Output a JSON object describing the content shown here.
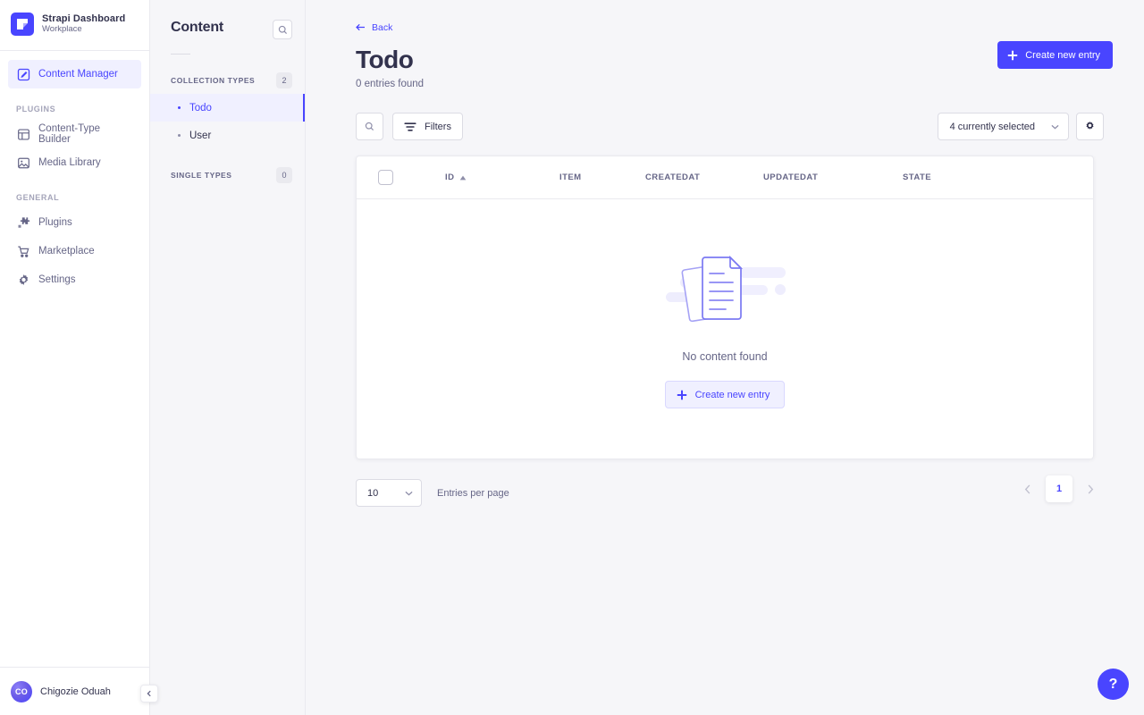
{
  "sidebar": {
    "brand": {
      "title": "Strapi Dashboard",
      "subtitle": "Workplace",
      "logo_icon": "strapi-logo-icon"
    },
    "primary_item": {
      "label": "Content Manager",
      "icon": "pencil-square-icon"
    },
    "sections": [
      {
        "label": "PLUGINS",
        "items": [
          {
            "label": "Content-Type Builder",
            "icon": "layout-icon"
          },
          {
            "label": "Media Library",
            "icon": "image-icon"
          }
        ]
      },
      {
        "label": "GENERAL",
        "items": [
          {
            "label": "Plugins",
            "icon": "puzzle-icon"
          },
          {
            "label": "Marketplace",
            "icon": "shopping-cart-icon"
          },
          {
            "label": "Settings",
            "icon": "gear-icon"
          }
        ]
      }
    ],
    "user": {
      "name": "Chigozie Oduah",
      "initials": "CO",
      "collapse_icon": "chevron-left-icon"
    }
  },
  "content_panel": {
    "title": "Content",
    "search_icon": "search-icon",
    "collection_types": {
      "label": "COLLECTION TYPES",
      "count": "2"
    },
    "collection_items": [
      {
        "label": "Todo",
        "active": true
      },
      {
        "label": "User",
        "active": false
      }
    ],
    "single_types": {
      "label": "SINGLE TYPES",
      "count": "0"
    }
  },
  "main": {
    "back_label": "Back",
    "back_icon": "arrow-left-icon",
    "title": "Todo",
    "subtitle": "0 entries found",
    "create_button": {
      "label": "Create new entry",
      "icon": "plus-icon"
    },
    "highlight_color": "#f20d0d",
    "accent_color": "#4945ff"
  },
  "toolbar": {
    "search_icon": "search-icon",
    "filters_label": "Filters",
    "filters_icon": "filter-icon",
    "field_select_value": "4 currently selected",
    "field_select_icon": "chevron-down-icon",
    "settings_icon": "cog-icon"
  },
  "table": {
    "select_all_checkbox": "select-all",
    "columns": [
      {
        "key": "id",
        "label": "ID",
        "sorted": true,
        "sort_icon": "caret-up-icon"
      },
      {
        "key": "item",
        "label": "ITEM",
        "sorted": false
      },
      {
        "key": "createdat",
        "label": "CREATEDAT",
        "sorted": false
      },
      {
        "key": "updatedat",
        "label": "UPDATEDAT",
        "sorted": false
      },
      {
        "key": "state",
        "label": "STATE",
        "sorted": false
      }
    ],
    "rows": [],
    "empty_state": {
      "illustration": "documents-illustration",
      "text": "No content found",
      "button_label": "Create new entry",
      "button_icon": "plus-icon"
    }
  },
  "pagination": {
    "per_page_value": "10",
    "per_page_label": "Entries per page",
    "per_page_icon": "chevron-down-icon",
    "prev_icon": "chevron-left-icon",
    "next_icon": "chevron-right-icon",
    "current_page": "1"
  },
  "help": {
    "label": "?",
    "icon": "question-mark-icon"
  }
}
